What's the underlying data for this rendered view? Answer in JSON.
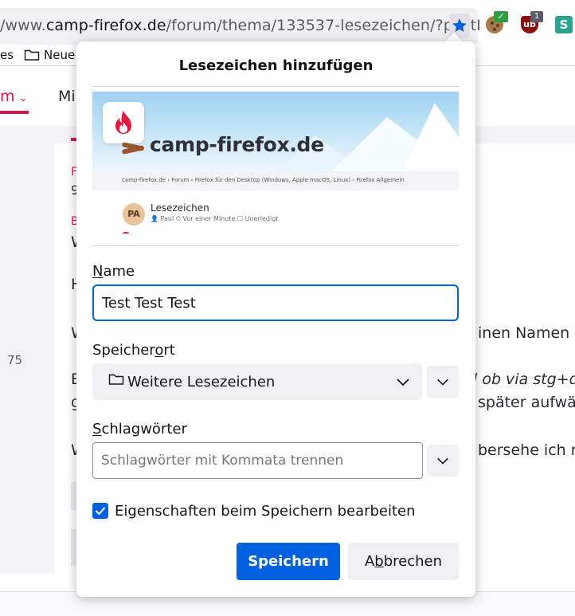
{
  "browser": {
    "url_prefix": "/www.",
    "url_host": "camp-firefox.de",
    "url_path": "/forum/thema/133537-lesezeichen/?postI",
    "extensions": {
      "check_badge": "✓",
      "ublock_label": "ub",
      "ublock_count": "1",
      "s_label": "S"
    }
  },
  "bookmarks_bar": {
    "items": [
      "es",
      "Neue"
    ]
  },
  "page": {
    "nav_forum": "m",
    "nav_mi": "Mi",
    "post_number": "75",
    "lines": {
      "l1": "F",
      "l2": "9",
      "l3": "B",
      "l4": "W",
      "l5": "H",
      "l6": "W",
      "l6_right": "inen Namen g",
      "l7": "E",
      "l7_right": "l ob via stg+d o",
      "l8": "g",
      "l8_right": "später aufwä",
      "l9": "W",
      "l9_right": "bersehe ich no"
    }
  },
  "dialog": {
    "title": "Lesezeichen hinzufügen",
    "preview": {
      "brand": "camp-firefox.de",
      "breadcrumb": "camp-firefox.de  ›  Forum  ›  Firefox für den Desktop (Windows, Apple macOS, Linux)  ›  Firefox Allgemein",
      "avatar_initials": "PA",
      "topic_title": "Lesezeichen",
      "topic_meta": "👤 Paul   ⏱ Vor einer Minute   ☐ Unerledigt"
    },
    "name_label_u": "N",
    "name_label_rest": "ame",
    "name_value": "Test Test Test",
    "location_label_pre": "Speicher",
    "location_label_u": "o",
    "location_label_post": "rt",
    "location_value": "Weitere Lesezeichen",
    "tags_label_u": "S",
    "tags_label_rest": "chlagwörter",
    "tags_placeholder": "Schlagwörter mit Kommata trennen",
    "edit_checkbox_pre": "Ei",
    "edit_checkbox_u": "g",
    "edit_checkbox_post": "enschaften beim Speichern bearbeiten",
    "edit_checkbox_checked": true,
    "save_label": "Speichern",
    "cancel_pre": "A",
    "cancel_u": "b",
    "cancel_post": "brechen"
  },
  "colors": {
    "accent": "#0061e0",
    "brand_red": "#d9154a"
  }
}
